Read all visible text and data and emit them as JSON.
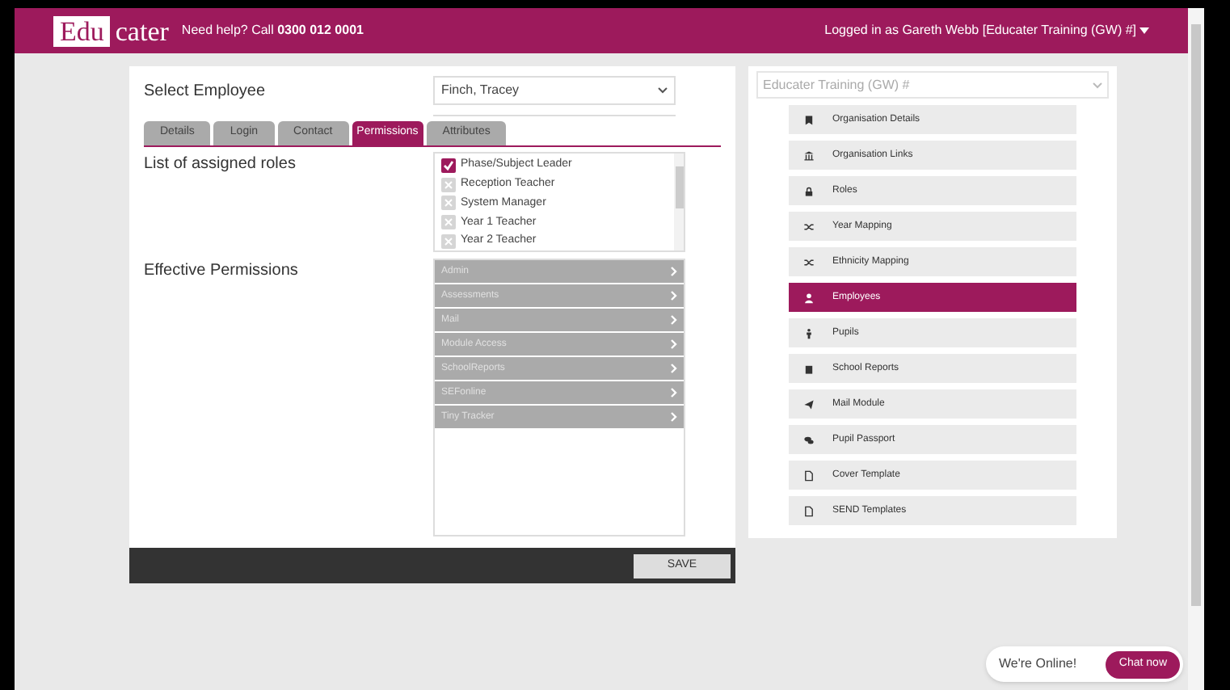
{
  "header": {
    "logo_box": "Edu",
    "logo_text": "cater",
    "help": "Need help? Call **0300 012 0001**",
    "user": "Logged in as Gareth Webb [Educater Training (GW) #]"
  },
  "employee": {
    "label": "Select Employee",
    "value": "Finch, Tracey"
  },
  "tabs": [
    {
      "label": "Details",
      "selected": false
    },
    {
      "label": "Login",
      "selected": false
    },
    {
      "label": "Contact",
      "selected": false
    },
    {
      "label": "Permissions",
      "selected": true
    },
    {
      "label": "Attributes",
      "selected": false
    }
  ],
  "roles": {
    "label": "List of assigned roles",
    "items": [
      {
        "label": "Phase/Subject Leader",
        "checked": true
      },
      {
        "label": "Reception Teacher",
        "checked": false
      },
      {
        "label": "System Manager",
        "checked": false
      },
      {
        "label": "Year 1 Teacher",
        "checked": false
      },
      {
        "label": "Year 2 Teacher",
        "checked": false
      }
    ]
  },
  "permissions": {
    "label": "Effective Permissions",
    "items": [
      "Admin",
      "Assessments",
      "Mail",
      "Module Access",
      "SchoolReports",
      "SEFonline",
      "Tiny Tracker"
    ]
  },
  "save_button": "SAVE",
  "organisation": {
    "value": "Educater Training (GW) #"
  },
  "menu": [
    {
      "label": "Organisation Details",
      "selected": false
    },
    {
      "label": "Organisation Links",
      "selected": false
    },
    {
      "label": "Roles",
      "selected": false
    },
    {
      "label": "Year Mapping",
      "selected": false
    },
    {
      "label": "Ethnicity Mapping",
      "selected": false
    },
    {
      "label": "Employees",
      "selected": true
    },
    {
      "label": "Pupils",
      "selected": false
    },
    {
      "label": "School Reports",
      "selected": false
    },
    {
      "label": "Mail Module",
      "selected": false
    },
    {
      "label": "Pupil Passport",
      "selected": false
    },
    {
      "label": "Cover Template",
      "selected": false
    },
    {
      "label": "SEND Templates",
      "selected": false
    }
  ],
  "chat": {
    "status": "We're Online!",
    "button": "Chat now"
  }
}
